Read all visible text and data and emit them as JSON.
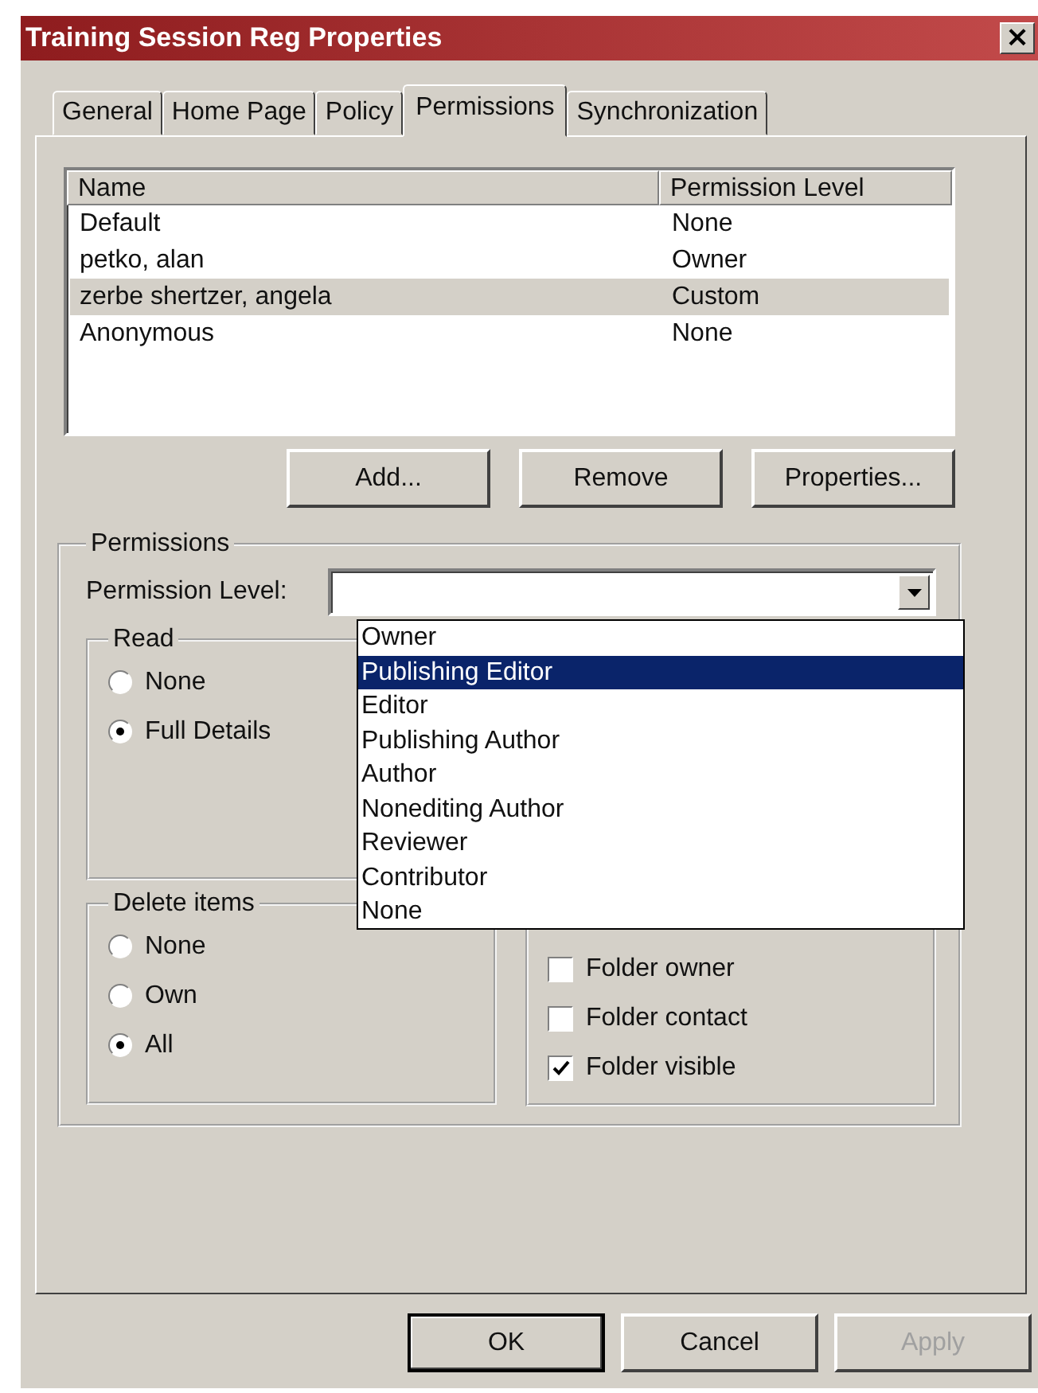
{
  "window": {
    "title": "Training Session Reg Properties",
    "close": "×"
  },
  "tabs": [
    {
      "label": "General",
      "selected": false
    },
    {
      "label": "Home Page",
      "selected": false
    },
    {
      "label": "Policy",
      "selected": false
    },
    {
      "label": "Permissions",
      "selected": true
    },
    {
      "label": "Synchronization",
      "selected": false
    }
  ],
  "list": {
    "columns": [
      "Name",
      "Permission Level"
    ],
    "rows": [
      {
        "name": "Default",
        "level_text": "None",
        "selected": false
      },
      {
        "name": "petko, alan",
        "level_text": "Owner",
        "selected": false
      },
      {
        "name": "zerbe shertzer, angela",
        "level_text": "Custom",
        "selected": true
      },
      {
        "name": "Anonymous",
        "level_text": "None",
        "selected": false
      }
    ]
  },
  "list_buttons": [
    "Add...",
    "Remove",
    "Properties..."
  ],
  "permissions": {
    "legend": "Permissions",
    "level_label": "Permission Level:",
    "dropdown": [
      {
        "label": "Owner",
        "selected": false
      },
      {
        "label": "Publishing Editor",
        "selected": true
      },
      {
        "label": "Editor",
        "selected": false
      },
      {
        "label": "Publishing Author",
        "selected": false
      },
      {
        "label": "Author",
        "selected": false
      },
      {
        "label": "Nonediting Author",
        "selected": false
      },
      {
        "label": "Reviewer",
        "selected": false
      },
      {
        "label": "Contributor",
        "selected": false
      },
      {
        "label": "None",
        "selected": false
      }
    ],
    "read": {
      "legend": "Read",
      "options": [
        {
          "label": "None",
          "selected": false
        },
        {
          "label": "Full Details",
          "selected": true
        }
      ]
    },
    "delete_items": {
      "legend": "Delete items",
      "options": [
        {
          "label": "None",
          "selected": false
        },
        {
          "label": "Own",
          "selected": false
        },
        {
          "label": "All",
          "selected": true
        }
      ]
    },
    "flags": [
      {
        "label": "Folder owner",
        "checked": false
      },
      {
        "label": "Folder contact",
        "checked": false
      },
      {
        "label": "Folder visible",
        "checked": true
      }
    ]
  },
  "footer_buttons": [
    {
      "label": "OK",
      "disabled": false,
      "default": true
    },
    {
      "label": "Cancel",
      "disabled": false,
      "default": false
    },
    {
      "label": "Apply",
      "disabled": true,
      "default": false
    }
  ]
}
